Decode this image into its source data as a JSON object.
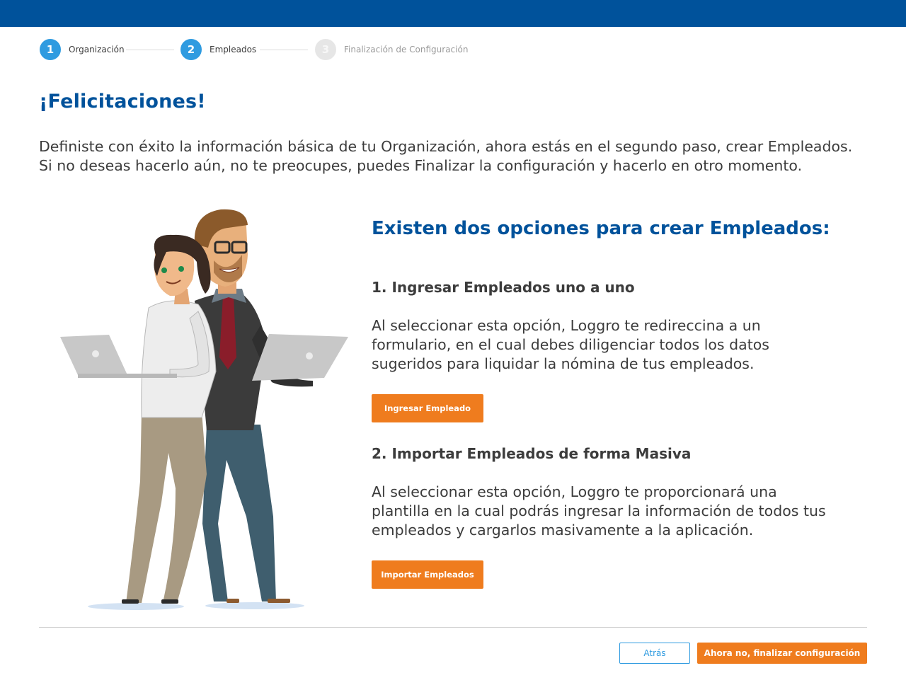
{
  "stepper": {
    "steps": [
      {
        "number": "1",
        "label": "Organización",
        "state": "active"
      },
      {
        "number": "2",
        "label": "Empleados",
        "state": "active"
      },
      {
        "number": "3",
        "label": "Finalización de Configuración",
        "state": "pending"
      }
    ]
  },
  "header": {
    "title": "¡Felicitaciones!",
    "intro": "Definiste con éxito la información básica de tu Organización, ahora estás en el segundo paso, crear Empleados. Si no deseas hacerlo aún, no te preocupes, puedes Finalizar la configuración y hacerlo en otro momento."
  },
  "options": {
    "title": "Existen dos opciones para crear Empleados:",
    "option1": {
      "heading": "1. Ingresar Empleados uno a uno",
      "text": "Al seleccionar esta opción, Loggro te redireccina a un formulario, en el cual debes diligenciar todos los datos sugeridos para liquidar la nómina de tus empleados.",
      "button": "Ingresar Empleado"
    },
    "option2": {
      "heading": "2. Importar Empleados de forma Masiva",
      "text": "Al seleccionar esta opción, Loggro te proporcionará una plantilla en la cual podrás ingresar la información de todos tus empleados y cargarlos masivamente a la aplicación.",
      "button": "Importar Empleados"
    }
  },
  "footer": {
    "back_label": "Atrás",
    "finish_label": "Ahora no, finalizar configuración"
  },
  "colors": {
    "brand_blue": "#00529b",
    "step_active": "#2f9be0",
    "accent_orange": "#ef7c1e"
  }
}
